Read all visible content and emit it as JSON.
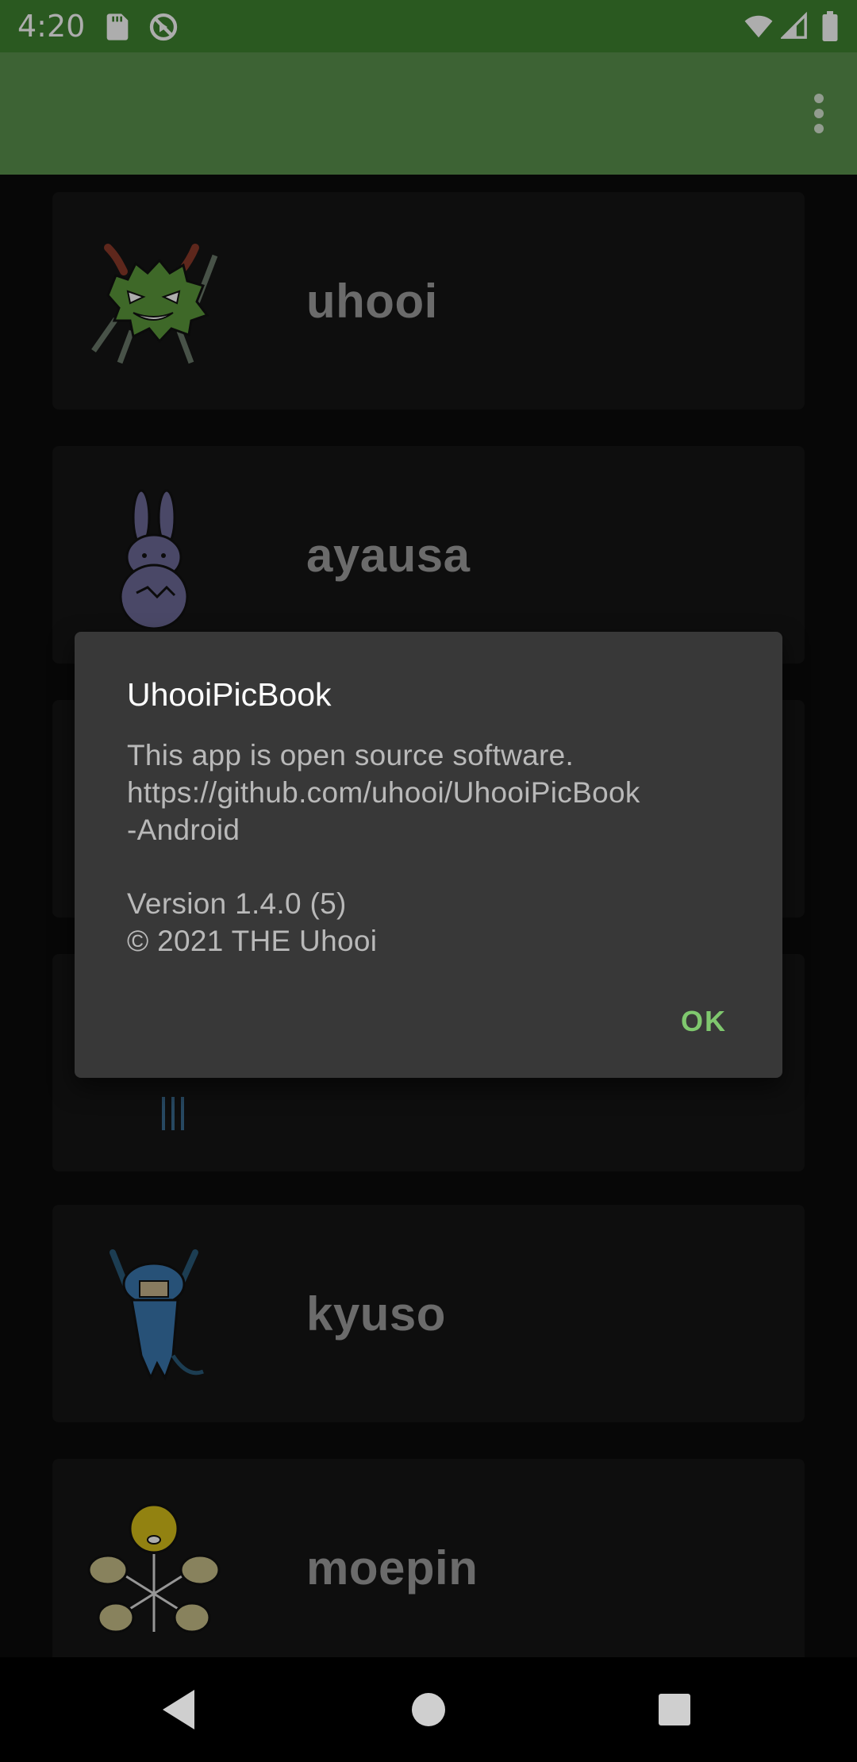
{
  "status_bar": {
    "time": "4:20",
    "icons_left": [
      "sd-card-icon",
      "sync-disabled-icon"
    ],
    "icons_right": [
      "wifi-icon",
      "cell-signal-icon",
      "battery-icon"
    ]
  },
  "app_bar": {
    "title": "",
    "overflow_icon": "more-vert-icon"
  },
  "list": {
    "items": [
      {
        "name": "uhooi",
        "icon": "uhooi-character"
      },
      {
        "name": "ayausa",
        "icon": "ayausa-character"
      },
      {
        "name": "",
        "icon": ""
      },
      {
        "name": "",
        "icon": "sonyeat-character"
      },
      {
        "name": "kyuso",
        "icon": "kyuso-character"
      },
      {
        "name": "moepin",
        "icon": "moepin-character"
      }
    ]
  },
  "dialog": {
    "title": "UhooiPicBook",
    "body_lines": [
      "This app is open source software.",
      "https://github.com/uhooi/UhooiPicBook",
      "-Android"
    ],
    "version": "Version 1.4.0 (5)",
    "copyright": "© 2021 THE Uhooi",
    "ok_label": "OK"
  },
  "nav_bar": {
    "back_icon": "back-icon",
    "home_icon": "home-icon",
    "recents_icon": "recents-icon"
  },
  "colors": {
    "status_bar": "#3f8330",
    "app_bar": "#5b924d",
    "background": "#0b0b0b",
    "card": "#151515",
    "dialog": "#383838",
    "accent": "#7fc86e"
  }
}
